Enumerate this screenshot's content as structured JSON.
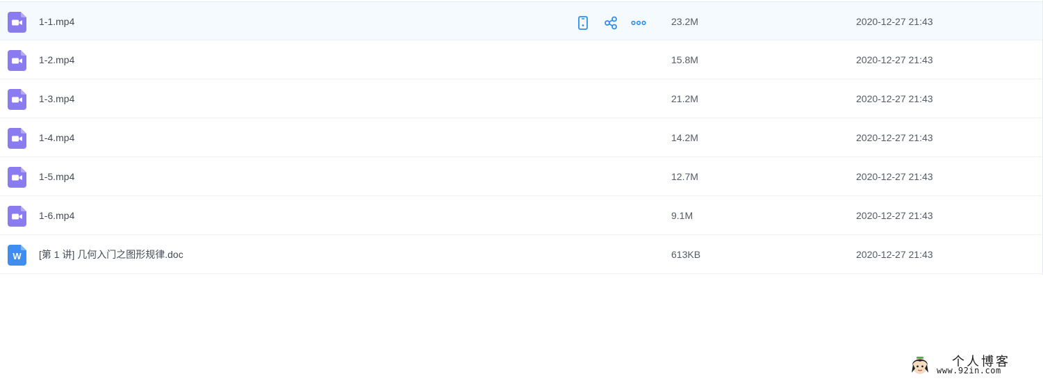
{
  "files": [
    {
      "name": "1-1.mp4",
      "type": "video",
      "size": "23.2M",
      "modified": "2020-12-27 21:43",
      "hovered": true
    },
    {
      "name": "1-2.mp4",
      "type": "video",
      "size": "15.8M",
      "modified": "2020-12-27 21:43"
    },
    {
      "name": "1-3.mp4",
      "type": "video",
      "size": "21.2M",
      "modified": "2020-12-27 21:43"
    },
    {
      "name": "1-4.mp4",
      "type": "video",
      "size": "14.2M",
      "modified": "2020-12-27 21:43"
    },
    {
      "name": "1-5.mp4",
      "type": "video",
      "size": "12.7M",
      "modified": "2020-12-27 21:43"
    },
    {
      "name": "1-6.mp4",
      "type": "video",
      "size": "9.1M",
      "modified": "2020-12-27 21:43"
    },
    {
      "name": "[第 1 讲] 几何入门之图形规律.doc",
      "type": "word",
      "size": "613KB",
      "modified": "2020-12-27 21:43"
    }
  ],
  "row_actions": [
    {
      "icon": "phone-icon"
    },
    {
      "icon": "share-icon"
    },
    {
      "icon": "more-icon"
    }
  ],
  "icons": {
    "video": "video-file-icon",
    "word": "word-file-icon"
  },
  "colors": {
    "video_icon": "#8a7cf0",
    "word_icon": "#3d8ef0",
    "action_blue": "#2e8ef0",
    "row_hover_bg": "#f4fafe"
  },
  "watermark": {
    "title": "个人博客",
    "url": "www.92in.com"
  }
}
